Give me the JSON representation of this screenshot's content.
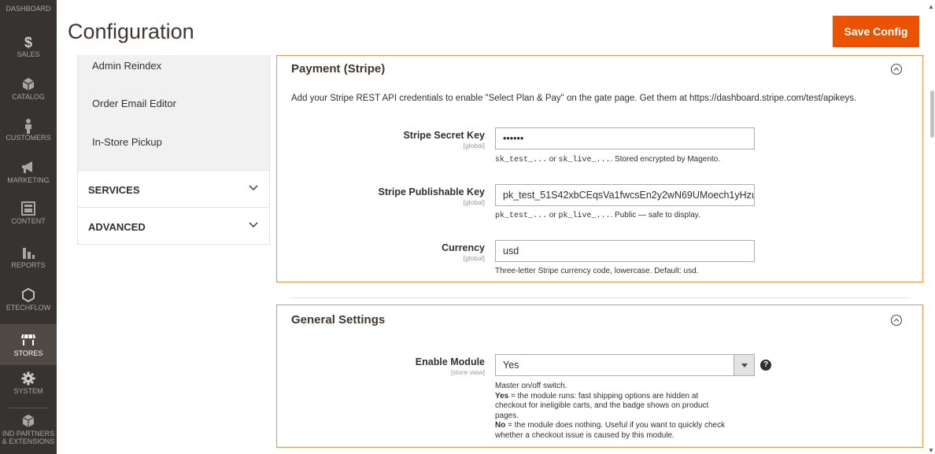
{
  "menu": {
    "items": [
      {
        "label": "DASHBOARD",
        "icon": "dashboard-icon"
      },
      {
        "label": "SALES",
        "icon": "dollar-icon"
      },
      {
        "label": "CATALOG",
        "icon": "box-icon"
      },
      {
        "label": "CUSTOMERS",
        "icon": "person-icon"
      },
      {
        "label": "MARKETING",
        "icon": "megaphone-icon"
      },
      {
        "label": "CONTENT",
        "icon": "layout-icon"
      },
      {
        "label": "REPORTS",
        "icon": "bar-chart-icon"
      },
      {
        "label": "ETECHFLOW",
        "icon": "hexagon-icon"
      },
      {
        "label": "STORES",
        "icon": "store-icon"
      },
      {
        "label": "SYSTEM",
        "icon": "gear-icon"
      },
      {
        "label": "IND PARTNERS",
        "label2": "& EXTENSIONS",
        "icon": "cubes-icon"
      }
    ],
    "active": "STORES"
  },
  "header": {
    "title": "Configuration",
    "save_label": "Save Config"
  },
  "tabs": {
    "links": [
      "Admin Reindex",
      "Order Email Editor",
      "In-Store Pickup"
    ],
    "groups": [
      "SERVICES",
      "ADVANCED"
    ]
  },
  "stripe": {
    "title": "Payment (Stripe)",
    "description": "Add your Stripe REST API credentials to enable \"Select Plan & Pay\" on the gate page. Get them at https://dashboard.stripe.com/test/apikeys.",
    "secret": {
      "label": "Stripe Secret Key",
      "scope": "[global]",
      "value": "••••••",
      "note_code1": "sk_test_...",
      "note_mid": " or ",
      "note_code2": "sk_live_...",
      "note_tail": ". Stored encrypted by Magento."
    },
    "publishable": {
      "label": "Stripe Publishable Key",
      "scope": "[global]",
      "value": "pk_test_51S42xbCEqsVa1fwcsEn2y2wN69UMoech1yHzu",
      "note_code1": "pk_test_...",
      "note_mid": " or ",
      "note_code2": "pk_live_...",
      "note_tail": ". Public — safe to display."
    },
    "currency": {
      "label": "Currency",
      "scope": "[global]",
      "value": "usd",
      "note": "Three-letter Stripe currency code, lowercase. Default: usd."
    }
  },
  "general": {
    "title": "General Settings",
    "enable": {
      "label": "Enable Module",
      "scope": "[store view]",
      "value": "Yes",
      "note_line1": "Master on/off switch.",
      "note_yes_bold": "Yes",
      "note_yes_text": " = the module runs: fast shipping options are hidden at",
      "note_line3": "checkout for ineligible carts, and the badge shows on product",
      "note_line4": "pages.",
      "note_no_bold": "No",
      "note_no_text": " = the module does nothing. Useful if you want to quickly check",
      "note_line6": "whether a checkout issue is caused by this module."
    }
  }
}
